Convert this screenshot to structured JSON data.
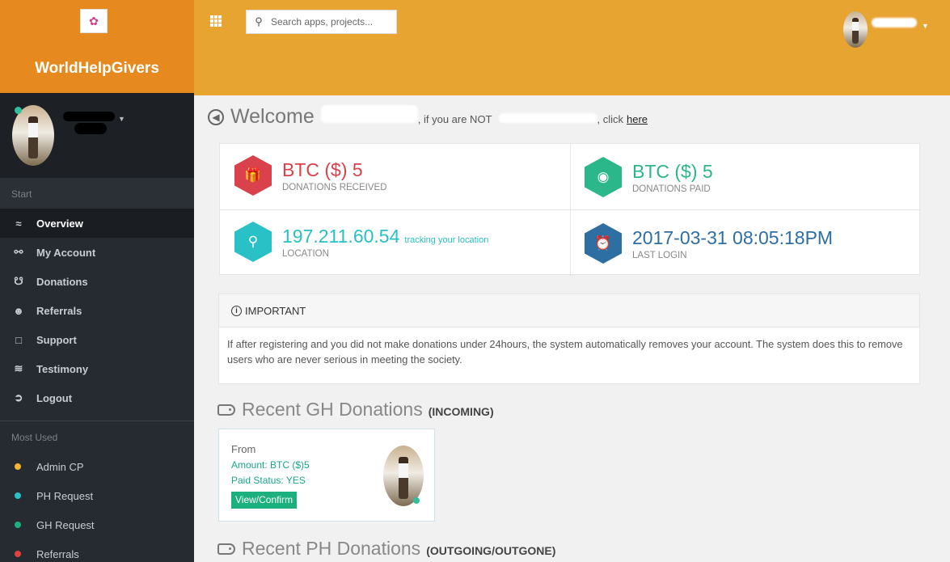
{
  "brand": {
    "name": "WorldHelpGivers",
    "logo_icon": "logo-icon"
  },
  "search": {
    "placeholder": "Search apps, projects..."
  },
  "sidebar": {
    "start_label": "Start",
    "items": [
      {
        "label": "Overview",
        "icon": "chart-line-icon",
        "active": true
      },
      {
        "label": "My Account",
        "icon": "user-icon"
      },
      {
        "label": "Donations",
        "icon": "donations-icon"
      },
      {
        "label": "Referrals",
        "icon": "users-icon"
      },
      {
        "label": "Support",
        "icon": "comment-icon"
      },
      {
        "label": "Testimony",
        "icon": "layers-icon"
      },
      {
        "label": "Logout",
        "icon": "logout-icon"
      }
    ],
    "most_used_label": "Most Used",
    "most_used": [
      {
        "label": "Admin CP",
        "color": "#f2b632"
      },
      {
        "label": "PH Request",
        "color": "#29c0c6"
      },
      {
        "label": "GH Request",
        "color": "#1bb07e"
      },
      {
        "label": "Referrals",
        "color": "#e0423e"
      }
    ]
  },
  "welcome": {
    "title": "Welcome",
    "not_text": ", if you are NOT",
    "click_text": ", click",
    "link": "here"
  },
  "stats": {
    "received": {
      "value": "BTC ($) 5",
      "label": "DONATIONS RECEIVED",
      "color": "#d9424a"
    },
    "paid": {
      "value": "BTC ($) 5",
      "label": "DONATIONS PAID",
      "color": "#2bb789"
    },
    "location": {
      "value": "197.211.60.54",
      "note": "tracking your location",
      "label": "LOCATION",
      "color": "#29c0c6"
    },
    "login": {
      "value": "2017-03-31 08:05:18PM",
      "label": "LAST LOGIN",
      "color": "#2d6ea3"
    }
  },
  "important": {
    "title": "IMPORTANT",
    "text": "If after registering and you did not make donations under 24hours, the system automatically removes your account. The system does this to remove users who are never serious in meeting the society."
  },
  "recent_gh": {
    "title": "Recent GH Donations",
    "badge": "(INCOMING)",
    "card": {
      "from": "From",
      "amount": "Amount: BTC ($)5",
      "paid_status": "Paid Status: YES",
      "button": "View/Confirm"
    }
  },
  "recent_ph": {
    "title": "Recent PH Donations",
    "badge": "(OUTGOING/OUTGONE)"
  }
}
